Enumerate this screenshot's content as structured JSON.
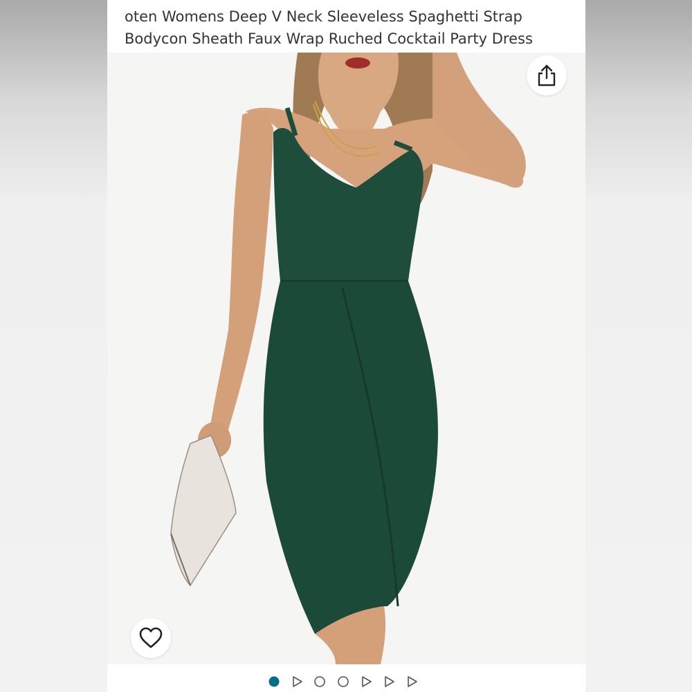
{
  "product": {
    "title_line1": "oten Womens Deep V Neck Sleeveless Spaghetti Strap",
    "title_line2": "Bodycon Sheath Faux Wrap Ruched Cocktail Party Dress"
  },
  "image": {
    "subject": "woman in dark green dress holding white clutch",
    "dress_color": "#1e4d3c"
  },
  "actions": {
    "share_icon": "share-icon",
    "wishlist_icon": "heart-icon"
  },
  "carousel": {
    "indicators": [
      {
        "type": "dot",
        "active": true
      },
      {
        "type": "video",
        "active": false
      },
      {
        "type": "dot",
        "active": false
      },
      {
        "type": "dot",
        "active": false
      },
      {
        "type": "video",
        "active": false
      },
      {
        "type": "video",
        "active": false
      },
      {
        "type": "video",
        "active": false
      }
    ],
    "active_color": "#007185",
    "inactive_color": "#555555"
  }
}
